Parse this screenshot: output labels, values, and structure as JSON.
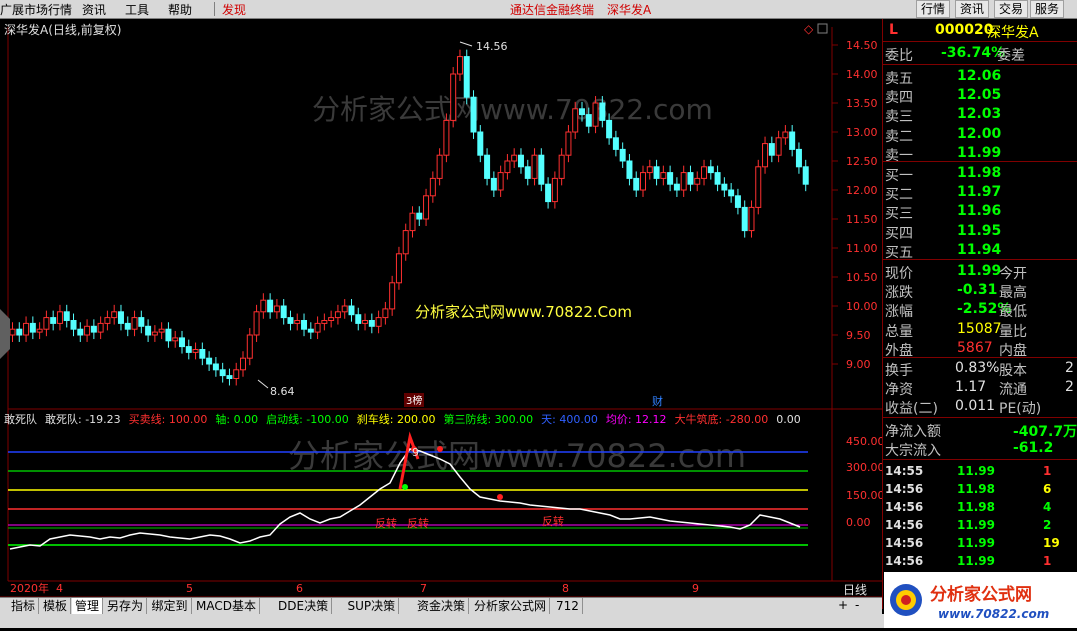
{
  "menu": {
    "items": [
      "广展市场行情",
      "资讯",
      "工具",
      "帮助",
      "发现"
    ],
    "center_title": "通达信金融终端",
    "center_stock": "深华发A",
    "right_buttons": [
      "行情",
      "资讯",
      "交易",
      "服务"
    ]
  },
  "chart": {
    "title": "深华发A(日线,前复权)",
    "high_label": "14.56",
    "low_label": "8.64",
    "watermark1": "分析家公式网www.70822.com",
    "watermark2": "分析家公式网www.70822.Com",
    "watermark3": "分析家公式网www.70822.com",
    "marker1": "3榜",
    "marker2": "财",
    "price_ticks": [
      "14.50",
      "14.00",
      "13.50",
      "13.00",
      "12.50",
      "12.00",
      "11.50",
      "11.00",
      "10.50",
      "10.00",
      "9.50",
      "9.00"
    ],
    "indicator_ticks": [
      "450.00",
      "300.00",
      "150.00",
      "0.00"
    ],
    "indicator_legend": {
      "name": "敢死队",
      "items": [
        {
          "label": "敢死队: -19.23",
          "color": "#e0e0e0"
        },
        {
          "label": "买卖线: 100.00",
          "color": "#ff3030"
        },
        {
          "label": "轴: 0.00",
          "color": "#00ff00"
        },
        {
          "label": "启动线: -100.00",
          "color": "#00ff00"
        },
        {
          "label": "刹车线: 200.00",
          "color": "#ffff00"
        },
        {
          "label": "第三防线: 300.00",
          "color": "#00ff00"
        },
        {
          "label": "天: 400.00",
          "color": "#3060ff"
        },
        {
          "label": "均价: 12.12",
          "color": "#ff00ff"
        },
        {
          "label": "大牛筑底: -280.00",
          "color": "#ff3030"
        },
        {
          "label": "0.00",
          "color": "#e0e0e0"
        }
      ]
    },
    "anno_9": "9",
    "anno_fan": [
      "反转",
      "反转",
      "反转"
    ],
    "date_labels": [
      "2020年",
      "4",
      "5",
      "6",
      "7",
      "8",
      "9"
    ],
    "period": "日线"
  },
  "quote": {
    "flag": "L",
    "code": "000020",
    "name": "深华发A",
    "weibi_label": "委比",
    "weibi": "-36.74%",
    "weicha_label": "委差",
    "sells": [
      {
        "label": "卖五",
        "price": "12.06"
      },
      {
        "label": "卖四",
        "price": "12.05"
      },
      {
        "label": "卖三",
        "price": "12.03"
      },
      {
        "label": "卖二",
        "price": "12.00"
      },
      {
        "label": "卖一",
        "price": "11.99"
      }
    ],
    "buys": [
      {
        "label": "买一",
        "price": "11.98"
      },
      {
        "label": "买二",
        "price": "11.97"
      },
      {
        "label": "买三",
        "price": "11.96"
      },
      {
        "label": "买四",
        "price": "11.95"
      },
      {
        "label": "买五",
        "price": "11.94"
      }
    ],
    "stats": [
      {
        "l1": "现价",
        "v1": "11.99",
        "c1": "v",
        "l2": "今开"
      },
      {
        "l1": "涨跌",
        "v1": "-0.31",
        "c1": "v",
        "l2": "最高"
      },
      {
        "l1": "涨幅",
        "v1": "-2.52%",
        "c1": "v",
        "l2": "最低"
      },
      {
        "l1": "总量",
        "v1": "15087",
        "c1": "yel",
        "l2": "量比"
      },
      {
        "l1": "外盘",
        "v1": "5867",
        "c1": "red",
        "l2": "内盘"
      }
    ],
    "stats2": [
      {
        "l1": "换手",
        "v1": "0.83%",
        "l2": "股本",
        "v2": "2"
      },
      {
        "l1": "净资",
        "v1": "1.17",
        "l2": "流通",
        "v2": "2"
      },
      {
        "l1": "收益(二)",
        "v1": "0.011",
        "l2": "PE(动)",
        "v2": ""
      }
    ],
    "flow": [
      {
        "label": "净流入额",
        "value": "-407.7万"
      },
      {
        "label": "大宗流入",
        "value": "-61.2"
      }
    ],
    "ticks": [
      {
        "t": "14:55",
        "p": "11.99",
        "v": "1",
        "vc": "red"
      },
      {
        "t": "14:56",
        "p": "11.98",
        "v": "6",
        "vc": "yel"
      },
      {
        "t": "14:56",
        "p": "11.98",
        "v": "4",
        "vc": "v"
      },
      {
        "t": "14:56",
        "p": "11.99",
        "v": "2",
        "vc": "v"
      },
      {
        "t": "14:56",
        "p": "11.99",
        "v": "19",
        "vc": "yel"
      },
      {
        "t": "14:56",
        "p": "11.99",
        "v": "1",
        "vc": "red"
      }
    ]
  },
  "bottom_tabs": [
    "指标",
    "模板",
    "管理",
    "另存为",
    "绑定到",
    "MACD基本",
    "DDE决策",
    "SUP决策",
    "资金决策",
    "分析家公式网",
    "712"
  ],
  "logo_text": "分析家公式网",
  "logo_url": "www.70822.com"
}
